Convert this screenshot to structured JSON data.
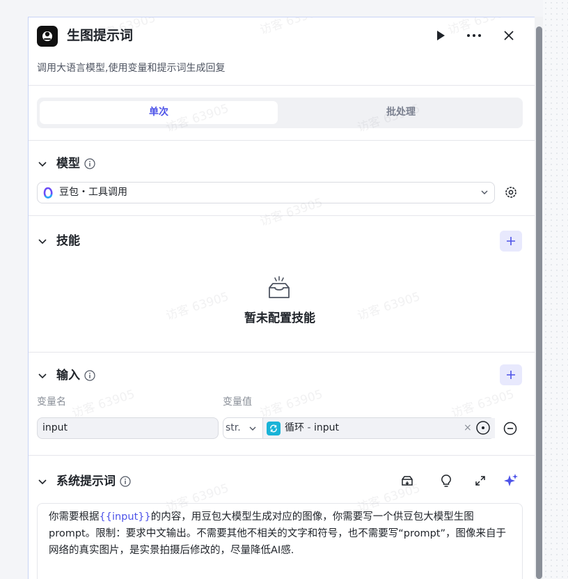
{
  "node": {
    "title": "生图提示词",
    "description": "调用大语言模型,使用变量和提示词生成回复"
  },
  "tabs": [
    {
      "label": "单次",
      "active": true
    },
    {
      "label": "批处理",
      "active": false
    }
  ],
  "model_section": {
    "title": "模型",
    "selected_model": "豆包・工具调用"
  },
  "skills_section": {
    "title": "技能",
    "empty_text": "暂未配置技能"
  },
  "input_section": {
    "title": "输入",
    "columns": {
      "name": "变量名",
      "value": "变量值"
    },
    "rows": [
      {
        "name": "input",
        "type": "str.",
        "source_node": "循环",
        "separator": "-",
        "source_var": "input"
      }
    ]
  },
  "system_prompt_section": {
    "title": "系统提示词",
    "prompt_segments": [
      {
        "text": "你需要根据",
        "is_var": false
      },
      {
        "text": "{{input}}",
        "is_var": true
      },
      {
        "text": "的内容，用豆包大模型生成对应的图像，你需要写一个供豆包大模型生图prompt。限制：要求中文输出。不需要其他不相关的文字和符号，也不需要写“prompt”，图像来自于网络的真实图片，是实景拍摄后修改的，尽量降低AI感.",
        "is_var": false
      }
    ]
  },
  "watermark": "访客 63905",
  "colors": {
    "accent": "#4d53e8",
    "plus_bg": "#e8e9fd",
    "loop_icon": "#19b3d7",
    "panel_border": "#c8d3f5"
  },
  "icons": {
    "node": "robot-icon",
    "run": "play-icon",
    "more": "more-dots-icon",
    "close": "close-icon",
    "collapse": "chevron-down-icon",
    "info": "info-icon",
    "model_logo": "doubao-logo-icon",
    "settings": "gear-icon",
    "add": "plus-icon",
    "empty": "empty-box-icon",
    "loop": "loop-icon",
    "target": "target-icon",
    "remove": "minus-circle-icon",
    "library": "prompt-library-icon",
    "bulb": "lightbulb-icon",
    "expand": "expand-icon",
    "ai_optimize": "sparkle-icon"
  }
}
